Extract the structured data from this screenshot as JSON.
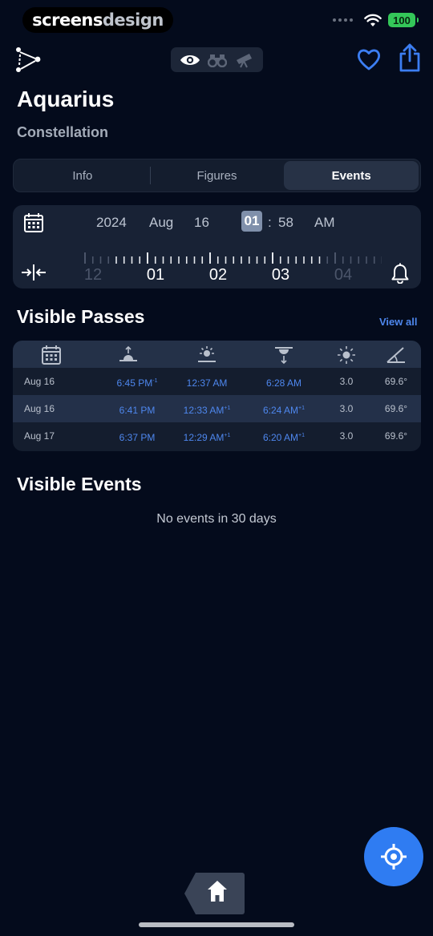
{
  "status": {
    "brand_a": "screens",
    "brand_b": "design",
    "battery": "100",
    "wifi_icon": "wifi-icon"
  },
  "toolbar": {
    "logo_icon": "constellation-icon",
    "modes": [
      "eye-icon",
      "binoculars-icon",
      "telescope-icon"
    ],
    "active_mode": "eye-icon",
    "favorite_icon": "heart-icon",
    "share_icon": "share-icon"
  },
  "header": {
    "title": "Aquarius",
    "subtitle": "Constellation"
  },
  "tabs": [
    {
      "label": "Info",
      "active": false
    },
    {
      "label": "Figures",
      "active": false
    },
    {
      "label": "Events",
      "active": true
    }
  ],
  "time": {
    "year": "2024",
    "month": "Aug",
    "day": "16",
    "hour": "01",
    "separator": ":",
    "minute": "58",
    "ampm": "AM",
    "ruler_labels": [
      "12",
      "01",
      "02",
      "03",
      "04"
    ]
  },
  "passes": {
    "title": "Visible Passes",
    "view_all": "View all",
    "columns": [
      "calendar-icon",
      "rise-icon",
      "transit-icon",
      "set-icon",
      "brightness-icon",
      "altitude-angle-icon"
    ],
    "rows": [
      {
        "date": "Aug 16",
        "rise": "6:45 PM",
        "rise_sup": "-1",
        "transit": "12:37 AM",
        "transit_sup": "",
        "set": "6:28 AM",
        "set_sup": "",
        "brightness": "3.0",
        "angle": "69.6°"
      },
      {
        "date": "Aug 16",
        "rise": "6:41 PM",
        "rise_sup": "",
        "transit": "12:33 AM",
        "transit_sup": "+1",
        "set": "6:24 AM",
        "set_sup": "+1",
        "brightness": "3.0",
        "angle": "69.6°"
      },
      {
        "date": "Aug 17",
        "rise": "6:37 PM",
        "rise_sup": "",
        "transit": "12:29 AM",
        "transit_sup": "+1",
        "set": "6:20 AM",
        "set_sup": "+1",
        "brightness": "3.0",
        "angle": "69.6°"
      }
    ]
  },
  "events": {
    "title": "Visible Events",
    "empty": "No events in 30 days"
  },
  "colors": {
    "background": "#040b1c",
    "accent": "#2f7cf2",
    "link": "#4e87ee"
  }
}
